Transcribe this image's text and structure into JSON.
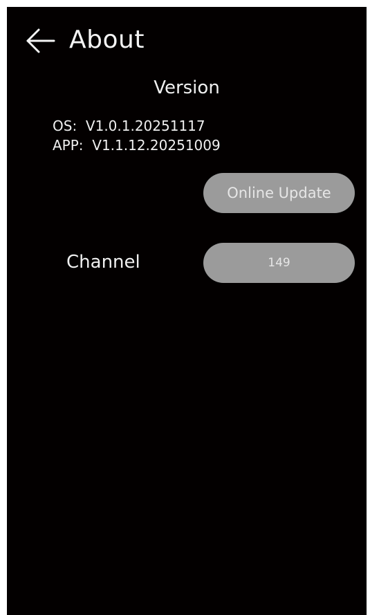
{
  "header": {
    "back_icon": "arrow-left-icon",
    "title": "About"
  },
  "version": {
    "heading": "Version",
    "os_label": "OS:",
    "os_value": "V1.0.1.20251117",
    "app_label": "APP:",
    "app_value": "V1.1.12.20251009"
  },
  "update": {
    "button_label": "Online Update"
  },
  "channel": {
    "label": "Channel",
    "value": "149"
  },
  "colors": {
    "background": "#030000",
    "text": "#f2f2f2",
    "pill_background": "#9b9b9b",
    "pill_text": "#e6e6e6"
  }
}
